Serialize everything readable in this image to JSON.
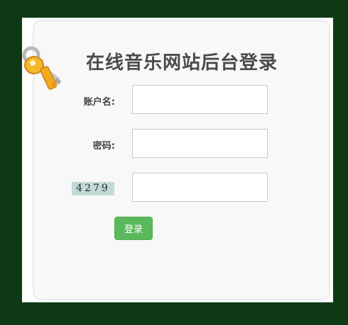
{
  "page": {
    "title": "在线音乐网站后台登录"
  },
  "form": {
    "username_label": "账户名:",
    "username_value": "",
    "password_label": "密码:",
    "password_value": "",
    "captcha_text": "4279",
    "captcha_value": "",
    "login_label": "登录"
  },
  "icons": {
    "logo": "keys-icon"
  },
  "colors": {
    "background": "#0d3a14",
    "panel": "#f8f8f8",
    "button": "#5cb85c",
    "title": "#4a4a4a"
  }
}
